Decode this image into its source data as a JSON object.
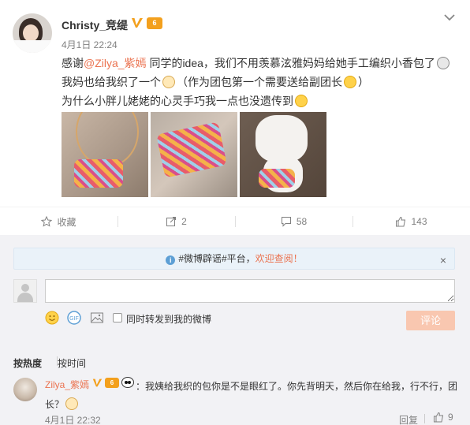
{
  "post": {
    "username": "Christy_竞缇",
    "time": "4月1日 22:24",
    "text": {
      "line1_prefix": "感谢",
      "mention": "@Zilya_紫嫣",
      "line1_suffix": " 同学的idea，我们不用羡慕泫雅妈妈给她手工编织小香包了",
      "line2_prefix": "我妈也给我织了一个",
      "line2_suffix": "（作为团包第一个需要送给副团长",
      "line2_end": "）",
      "line3": "为什么小胖儿姥姥的心灵手巧我一点也没遗传到"
    },
    "icons": [
      "avatar",
      "verified-icon",
      "vip-icon",
      "chevron-down-icon"
    ]
  },
  "actions": {
    "favorite_label": "收藏",
    "repost_count": "2",
    "comment_count": "58",
    "like_count": "143"
  },
  "comment_panel": {
    "notice_prefix": "#微博辟谣#平台，",
    "notice_link": "欢迎查阅！",
    "notice_close": "×",
    "input_value": "",
    "forward_label": "同时转发到我的微博",
    "submit_label": "评论",
    "sort_hot": "按热度",
    "sort_time": "按时间"
  },
  "comments": [
    {
      "username": "Zilya_紫嫣",
      "text_line1": "：我姨给我织的包你是不是眼红了。你先背明天，然后你在给我，行不行，团",
      "text_line2": "长？",
      "time": "4月1日 22:32",
      "reply_label": "回复",
      "like_count": "9"
    }
  ],
  "colors": {
    "accent": "#eb7350",
    "submit_disabled": "#f9c7b0",
    "panel_bg": "#f2f2f5"
  }
}
